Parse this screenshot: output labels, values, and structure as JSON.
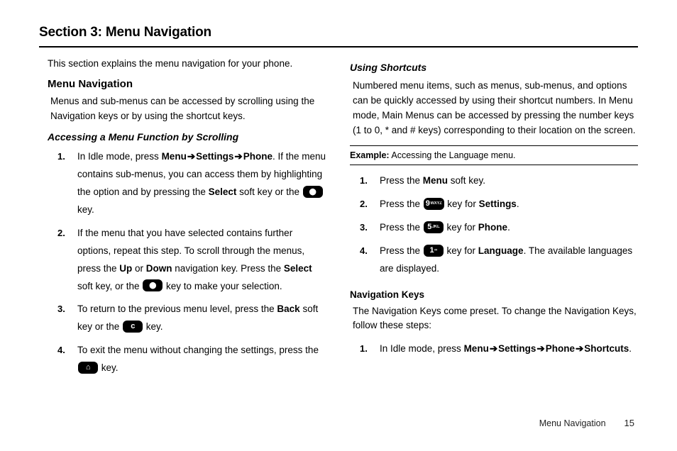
{
  "section_title": "Section 3: Menu Navigation",
  "footer": {
    "label": "Menu Navigation",
    "page": "15"
  },
  "left": {
    "intro": "This section explains the menu navigation for your phone.",
    "h2": "Menu Navigation",
    "p1": "Menus and sub-menus can be accessed by scrolling using the Navigation keys or by using the shortcut keys.",
    "h3": "Accessing a Menu Function by Scrolling",
    "steps": {
      "s1a": "In Idle mode, press ",
      "s1_menu": "Menu",
      "s1_arrow1": " ➔ ",
      "s1_settings": "Settings",
      "s1_arrow2": " ➔ ",
      "s1_phone": "Phone",
      "s1b": ". If the menu contains sub-menus, you can access them by highlighting the option and by pressing the ",
      "s1_select": "Select",
      "s1c": " soft key or the ",
      "s1d": " key.",
      "s2a": "If the menu that you have selected contains further options, repeat this step. To scroll through the menus, press the ",
      "s2_up": "Up",
      "s2b": " or ",
      "s2_down": "Down",
      "s2c": " navigation key. Press the ",
      "s2_select": "Select",
      "s2d": " soft key, or the ",
      "s2e": " key to make your selection.",
      "s3a": "To return to the previous menu level, press the ",
      "s3_back": "Back",
      "s3b": " soft key or the ",
      "s3c": " key.",
      "s4a": "To exit the menu without changing the settings, press the ",
      "s4b": " key."
    }
  },
  "right": {
    "h3a": "Using Shortcuts",
    "p1": "Numbered menu items, such as menus, sub-menus, and options can be quickly accessed by using their shortcut numbers. In Menu mode, Main Menus can be accessed by pressing the number keys (1 to 0, * and # keys) corresponding to their location on the screen.",
    "example_label": "Example:",
    "example_text": " Accessing the Language menu.",
    "steps": {
      "s1a": "Press the ",
      "s1_menu": "Menu",
      "s1b": " soft key.",
      "s2a": "Press the ",
      "s2b": " key for ",
      "s2_settings": "Settings",
      "s2c": ".",
      "s3a": "Press the ",
      "s3b": " key for ",
      "s3_phone": "Phone",
      "s3c": ".",
      "s4a": "Press the ",
      "s4b": " key for ",
      "s4_lang": "Language",
      "s4c": ". The available languages are displayed."
    },
    "h3b": "Navigation Keys",
    "p2": "The Navigation Keys come preset. To change the Navigation Keys, follow these steps:",
    "nav_steps": {
      "s1a": "In Idle mode, press ",
      "s1_menu": "Menu",
      "s1_arrow1": " ➔ ",
      "s1_settings": "Settings",
      "s1_arrow2": " ➔ ",
      "s1_phone": "Phone",
      "s1_arrow3": " ➔ ",
      "s1_shortcuts": "Shortcuts",
      "s1b": "."
    }
  },
  "keys": {
    "ok": "⬤",
    "c": "ᴄ",
    "end": "⌂",
    "nine": "9",
    "nine_sub": "WXYZ",
    "five": "5",
    "five_sub": "JKL",
    "one": "1",
    "one_sub": "∞"
  }
}
